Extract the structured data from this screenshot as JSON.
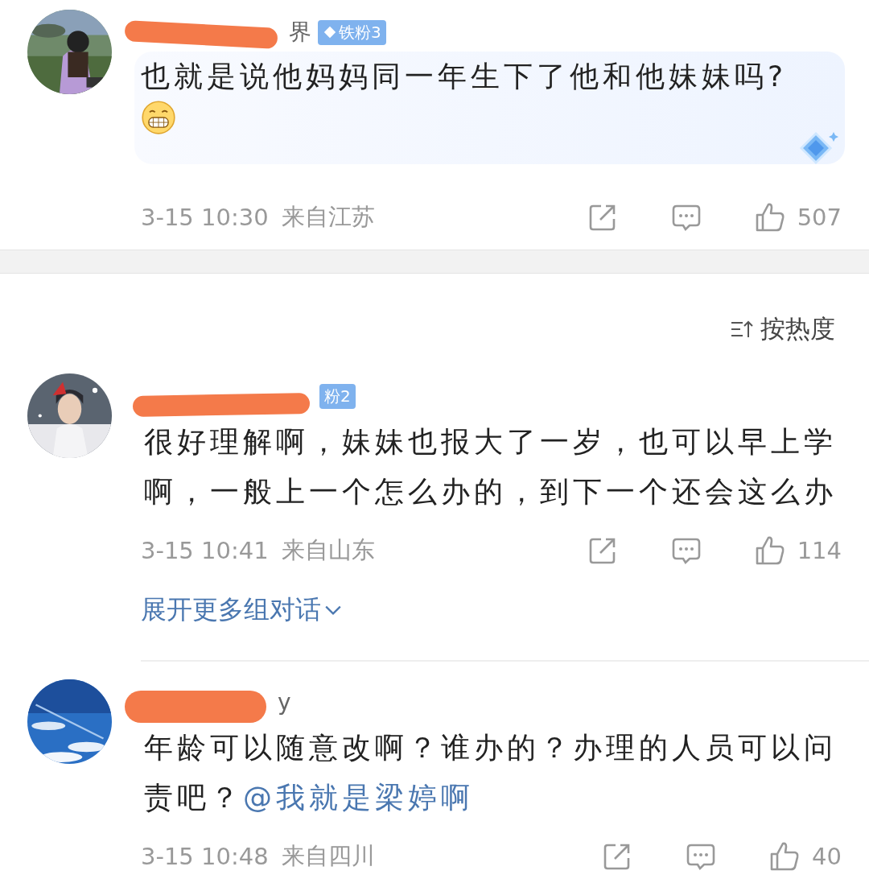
{
  "comments": [
    {
      "name": "界",
      "badge": "铁粉3",
      "badge_icon": true,
      "bubble": true,
      "emoji": true,
      "lines": [
        [
          {
            "text": "也就是说他妈妈同一年生下了他和他妹妹吗?"
          }
        ]
      ],
      "time": "3-15 10:30",
      "location": "来自江苏",
      "likes": "507"
    },
    {
      "badge": "粉2",
      "badge_icon": false,
      "bubble": false,
      "emoji": false,
      "lines": [
        [
          {
            "text": "很好理解啊，妹妹也报大了一岁，也可以早上学"
          }
        ],
        [
          {
            "text": "啊，一般上一个怎么办的，到下一个还会这么办"
          }
        ]
      ],
      "time": "3-15 10:41",
      "location": "来自山东",
      "likes": "114",
      "more_link": "展开更多组对话"
    },
    {
      "name": "y",
      "bubble": false,
      "emoji": false,
      "lines": [
        [
          {
            "text": "年龄可以随意改啊？谁办的？办理的人员可以问"
          }
        ],
        [
          {
            "text": "责吧？"
          },
          {
            "text": "@我就是梁婷啊",
            "kind": "mention"
          }
        ]
      ],
      "time": "3-15 10:48",
      "location": "来自四川",
      "likes": "40"
    }
  ],
  "sort": {
    "label": "按热度"
  }
}
